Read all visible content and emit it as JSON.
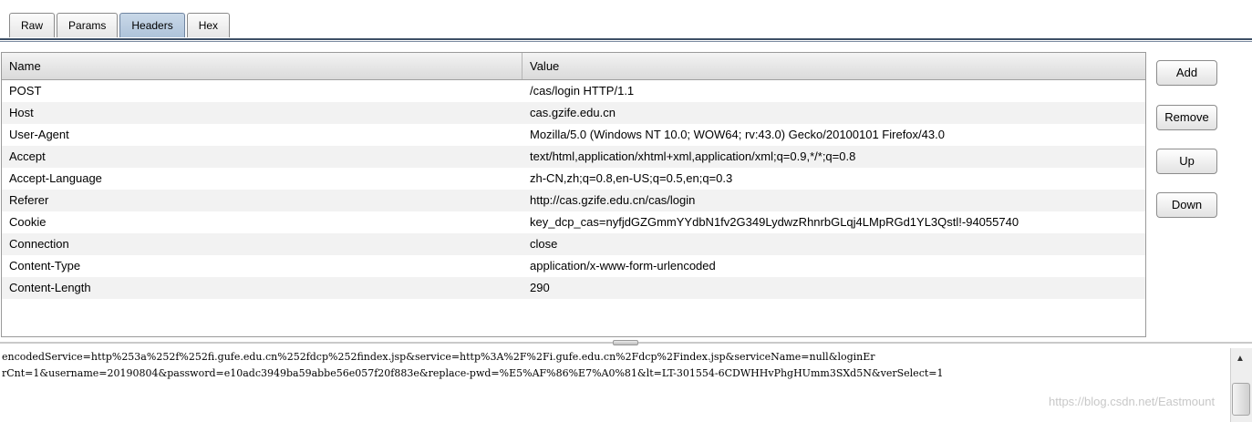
{
  "tabs": [
    "Raw",
    "Params",
    "Headers",
    "Hex"
  ],
  "active_tab": "Headers",
  "table": {
    "headers": [
      "Name",
      "Value"
    ],
    "rows": [
      {
        "name": "POST",
        "value": "/cas/login HTTP/1.1"
      },
      {
        "name": "Host",
        "value": "cas.gzife.edu.cn"
      },
      {
        "name": "User-Agent",
        "value": "Mozilla/5.0 (Windows NT 10.0; WOW64; rv:43.0) Gecko/20100101 Firefox/43.0"
      },
      {
        "name": "Accept",
        "value": "text/html,application/xhtml+xml,application/xml;q=0.9,*/*;q=0.8"
      },
      {
        "name": "Accept-Language",
        "value": "zh-CN,zh;q=0.8,en-US;q=0.5,en;q=0.3"
      },
      {
        "name": "Referer",
        "value": "http://cas.gzife.edu.cn/cas/login"
      },
      {
        "name": "Cookie",
        "value": "key_dcp_cas=nyfjdGZGmmYYdbN1fv2G349LydwzRhnrbGLqj4LMpRGd1YL3Qstl!-94055740"
      },
      {
        "name": "Connection",
        "value": "close"
      },
      {
        "name": "Content-Type",
        "value": "application/x-www-form-urlencoded"
      },
      {
        "name": "Content-Length",
        "value": "290"
      }
    ]
  },
  "buttons": {
    "add": "Add",
    "remove": "Remove",
    "up": "Up",
    "down": "Down"
  },
  "body": {
    "line1": "encodedService=http%253a%252f%252fi.gufe.edu.cn%252fdcp%252findex.jsp&service=http%3A%2F%2Fi.gufe.edu.cn%2Fdcp%2Findex.jsp&serviceName=null&loginEr",
    "line2": "rCnt=1&username=20190804&password=e10adc3949ba59abbe56e057f20f883e&replace-pwd=%E5%AF%86%E7%A0%81&lt=LT-301554-6CDWHHvPhgHUmm3SXd5N&verSelect=1"
  },
  "watermark": "https://blog.csdn.net/Eastmount",
  "icons": {
    "scroll_up": "up-arrow-icon"
  }
}
